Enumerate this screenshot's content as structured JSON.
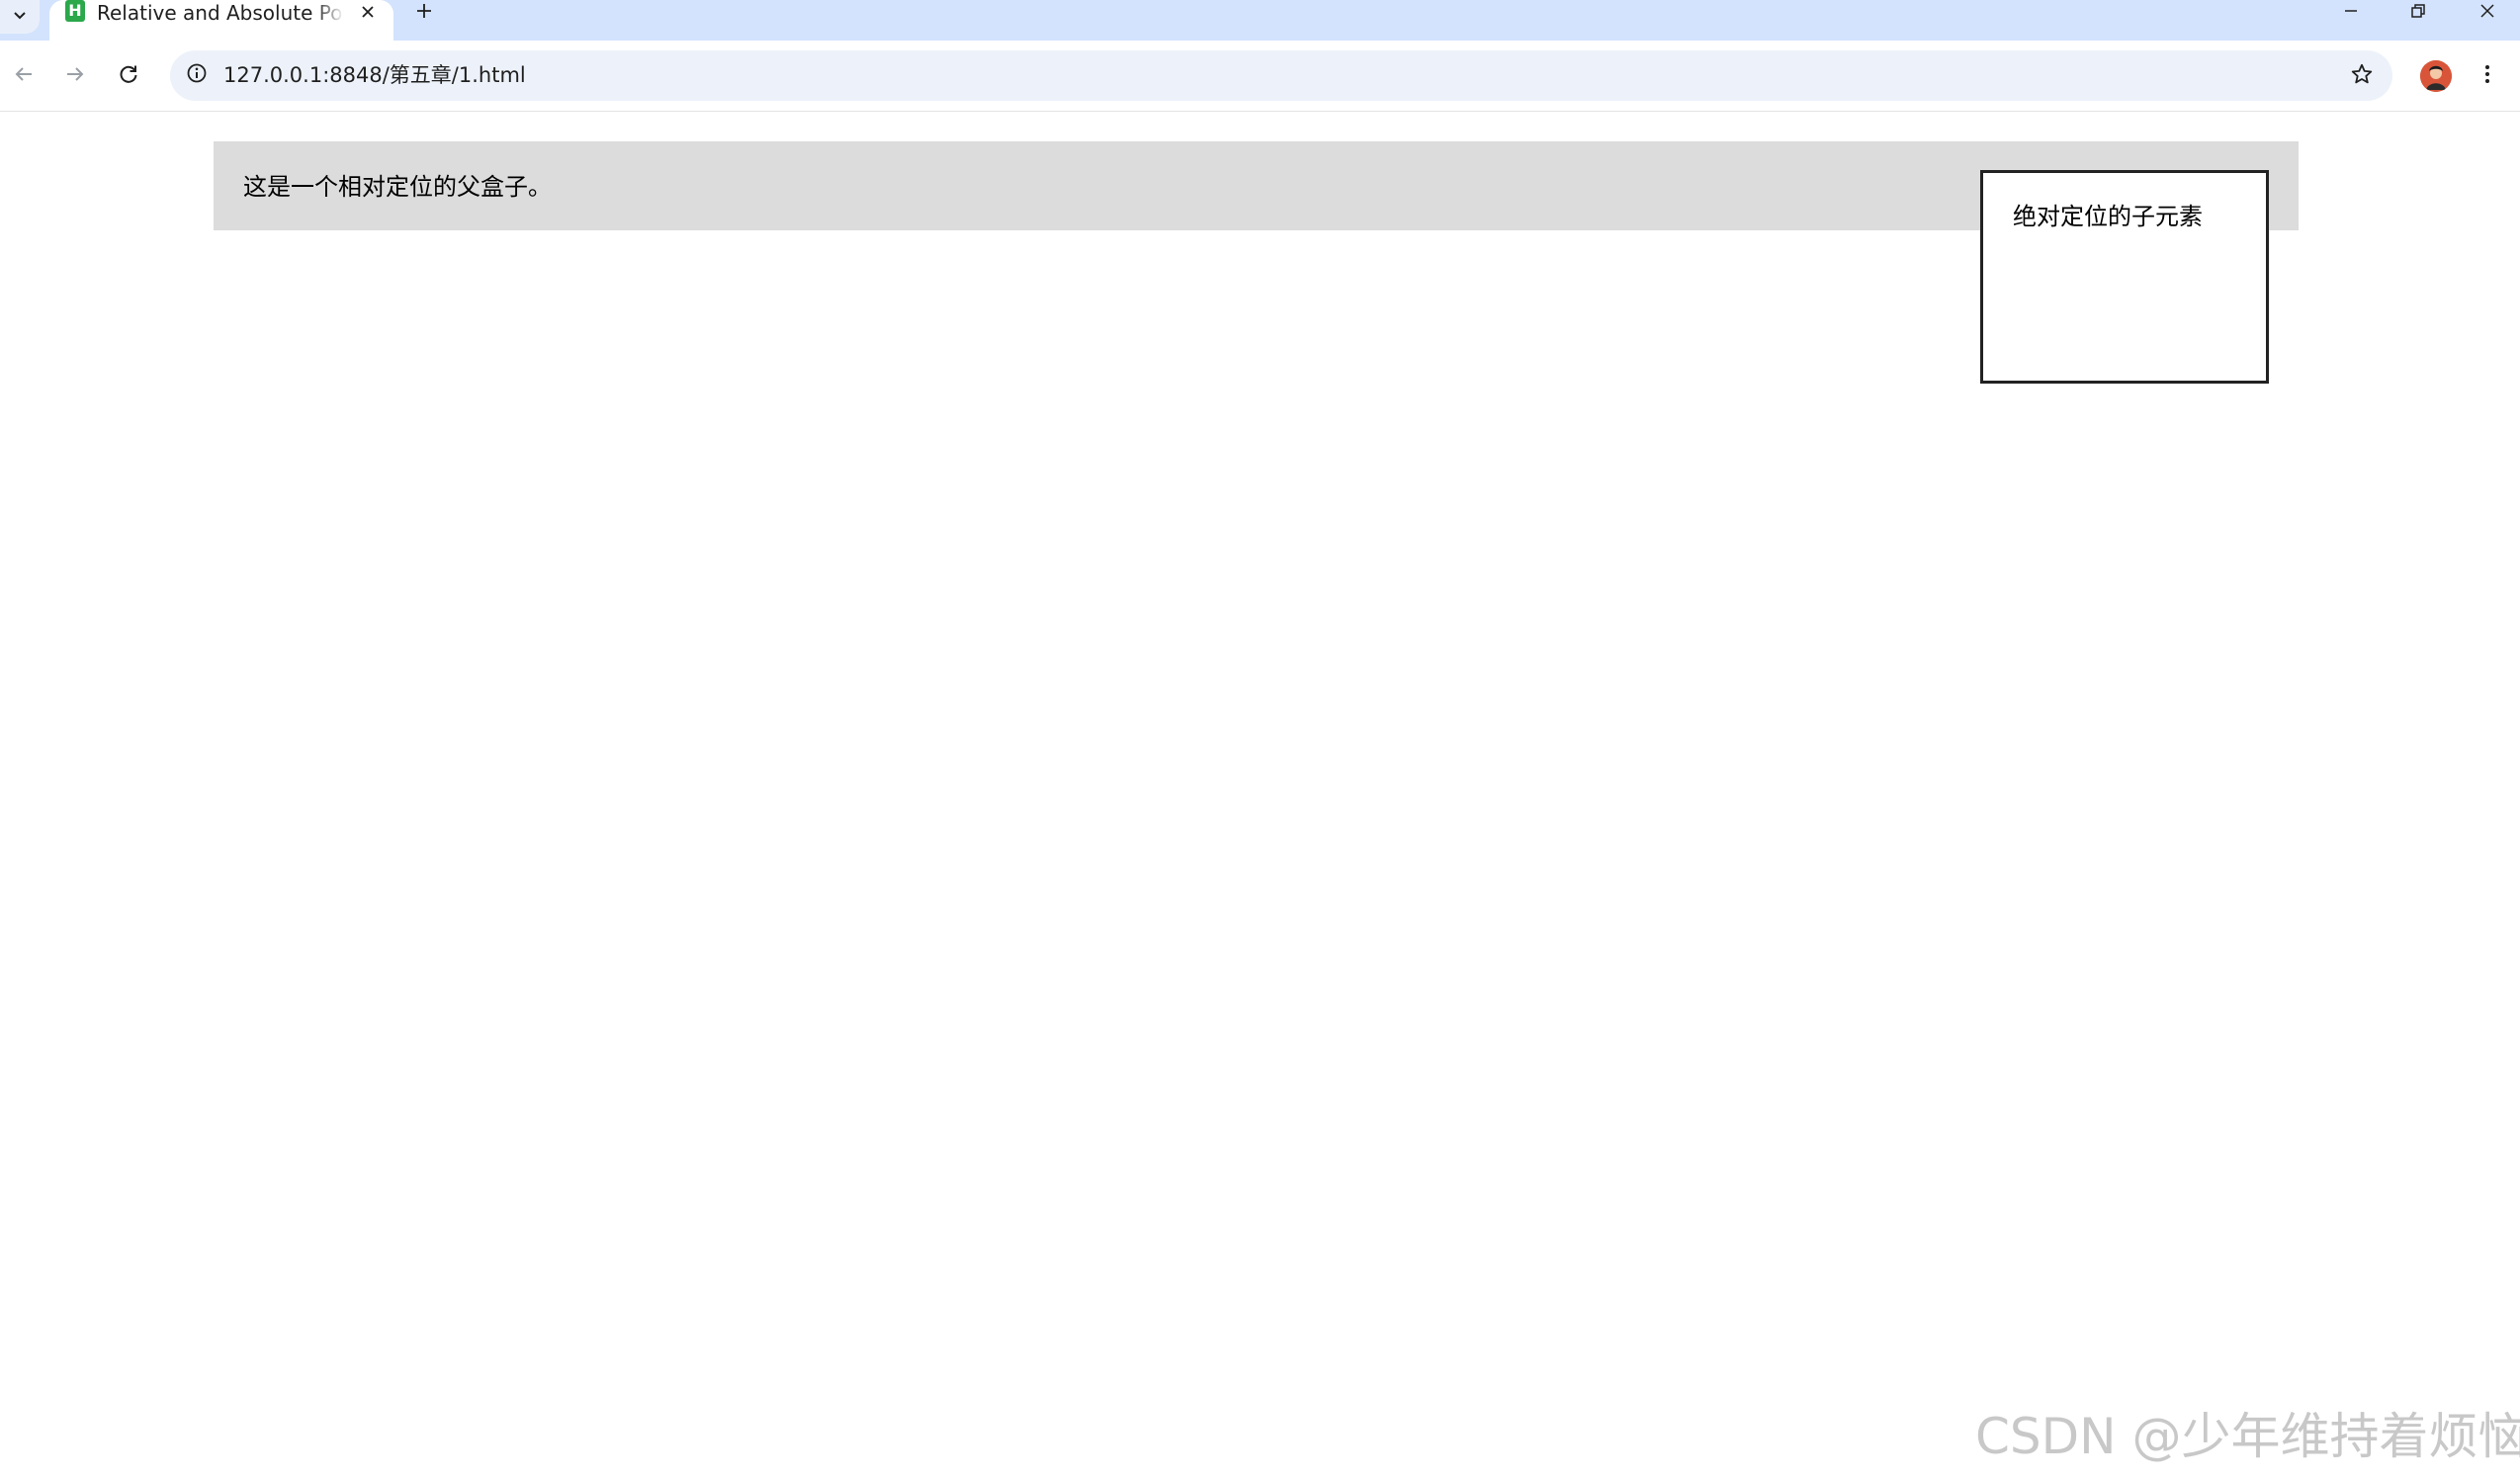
{
  "browser": {
    "tab": {
      "title": "Relative and Absolute Positioning",
      "favicon_letter": "H"
    },
    "address_bar": {
      "url": "127.0.0.1:8848/第五章/1.html"
    },
    "icons": {
      "tab_search": "chevron-down-icon",
      "tab_close": "close-icon",
      "new_tab": "plus-icon",
      "minimize": "minimize-icon",
      "restore": "restore-icon",
      "close_window": "close-icon",
      "back": "arrow-left-icon",
      "forward": "arrow-right-icon",
      "reload": "reload-icon",
      "site_info": "info-icon",
      "bookmark": "star-icon",
      "menu": "kebab-menu-icon"
    }
  },
  "page": {
    "parent_text": "这是一个相对定位的父盒子。",
    "child_text": "绝对定位的子元素"
  },
  "watermark": "CSDN @少年维持着烦恼.",
  "colors": {
    "tabstrip_bg": "#d3e3fd",
    "omnibox_bg": "#edf2fa",
    "parent_bg": "#dcdcdc",
    "child_border": "#222222",
    "favicon": "#2aa84a"
  }
}
